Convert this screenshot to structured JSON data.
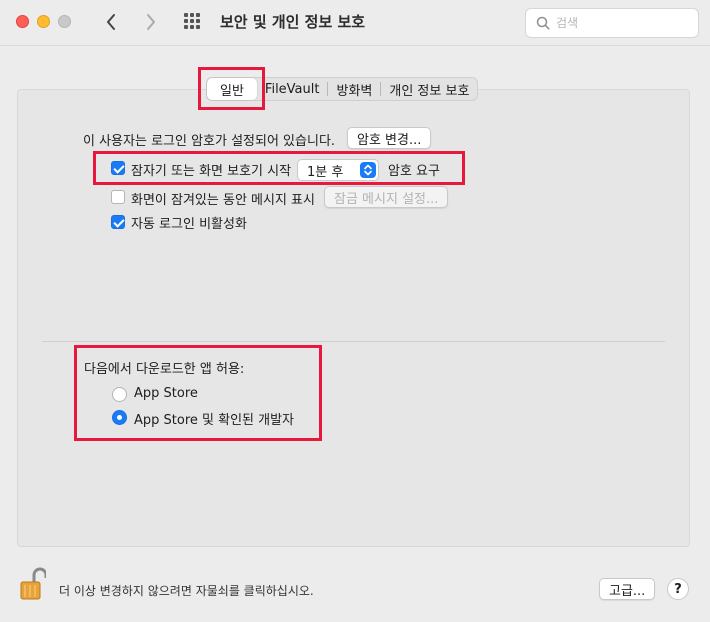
{
  "window": {
    "title": "보안 및 개인 정보 보호",
    "search_placeholder": "검색"
  },
  "tabs": [
    {
      "label": "일반",
      "active": true
    },
    {
      "label": "FileVault",
      "active": false
    },
    {
      "label": "방화벽",
      "active": false
    },
    {
      "label": "개인 정보 보호",
      "active": false
    }
  ],
  "general": {
    "password_set_text": "이 사용자는 로그인 암호가 설정되어 있습니다.",
    "change_password_button": "암호 변경...",
    "require_password": {
      "label": "잠자기 또는 화면 보호기 시작",
      "checked": true,
      "delay_value": "1분 후",
      "suffix": "암호 요구"
    },
    "show_message": {
      "label": "화면이 잠겨있는 동안 메시지 표시",
      "checked": false,
      "button": "잠금 메시지 설정..."
    },
    "disable_auto_login": {
      "label": "자동 로그인 비활성화",
      "checked": true
    }
  },
  "allow_apps": {
    "heading": "다음에서 다운로드한 앱 허용:",
    "options": [
      {
        "label": "App Store",
        "selected": false
      },
      {
        "label": "App Store 및 확인된 개발자",
        "selected": true
      }
    ]
  },
  "footer": {
    "lock_text": "더 이상 변경하지 않으려면 자물쇠를 클릭하십시오.",
    "advanced_button": "고급...",
    "help_label": "?"
  },
  "colors": {
    "accent": "#1a7cf5",
    "highlight_box": "#e8183c"
  }
}
